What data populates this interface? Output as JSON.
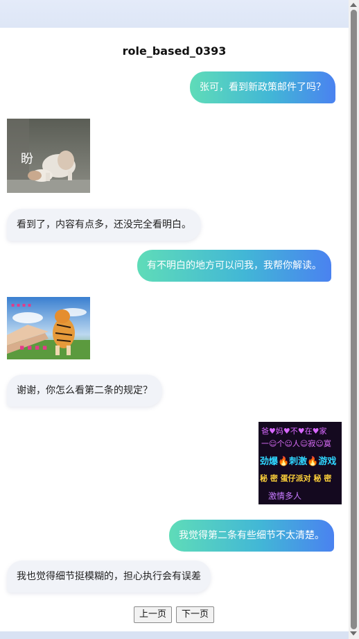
{
  "conversation": {
    "title": "role_based_0393",
    "messages": [
      {
        "side": "right",
        "type": "text",
        "text": "张可，看到新政策邮件了吗？"
      },
      {
        "side": "left",
        "type": "sticker",
        "sticker": "cat-bowing",
        "caption": "盼"
      },
      {
        "side": "left",
        "type": "text",
        "text": "看到了，内容有点多，还没完全看明白。"
      },
      {
        "side": "right",
        "type": "text",
        "text": "有不明白的地方可以问我，我帮你解读。"
      },
      {
        "side": "left",
        "type": "sticker",
        "sticker": "tiger-hands"
      },
      {
        "side": "left",
        "type": "text",
        "text": "谢谢，你怎么看第二条的规定？"
      },
      {
        "side": "right",
        "type": "sticker",
        "sticker": "neon-party-poster",
        "lines": [
          "爸♥妈♥不♥在♥家",
          "一☺个☺人☺寂☺寞",
          "劲爆🔥刺激🔥游戏",
          "秘 密 蛋仔派对 秘 密",
          "激情多人"
        ]
      },
      {
        "side": "right",
        "type": "text",
        "text": "我觉得第二条有些细节不太清楚。"
      },
      {
        "side": "left",
        "type": "text",
        "text": "我也觉得细节挺模糊的，担心执行会有误差"
      }
    ]
  },
  "pagination": {
    "prev_label": "上一页",
    "next_label": "下一页"
  },
  "colors": {
    "bubble_gradient_start": "#5fdcb8",
    "bubble_gradient_end": "#4a82f0",
    "left_bubble": "#f1f3f8"
  }
}
